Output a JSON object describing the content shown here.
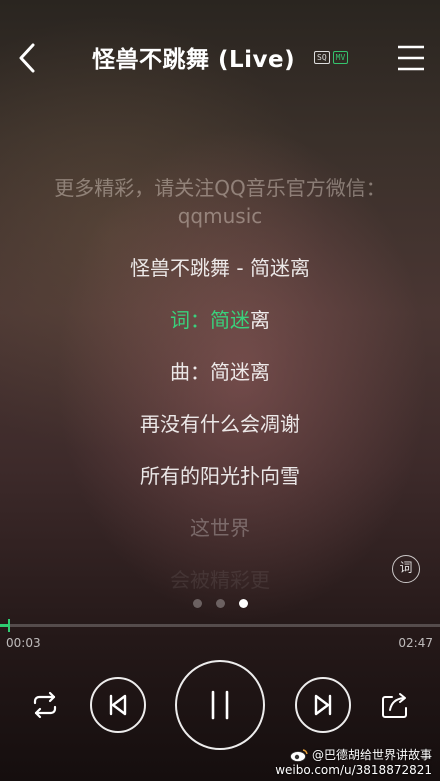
{
  "header": {
    "title": "怪兽不跳舞 (Live)",
    "badge_sq": "SQ",
    "badge_mv": "MV"
  },
  "lyrics": [
    "更多精彩，请关注QQ音乐官方微信：qqmusic",
    "怪兽不跳舞 - 简迷离",
    {
      "highlighted": "词：简迷",
      "rest": "离"
    },
    "曲：简迷离",
    "再没有什么会凋谢",
    "所有的阳光扑向雪",
    "这世界",
    "会被精彩更"
  ],
  "lyric_button": "词",
  "pager": {
    "pages": 3,
    "active_index": 2
  },
  "playback": {
    "current_time": "00:03",
    "total_time": "02:47",
    "progress_fraction": 0.02
  },
  "colors": {
    "accent": "#2ecc71"
  },
  "watermark": {
    "line1": "@巴德胡给世界讲故事",
    "line2": "weibo.com/u/3818872821"
  },
  "icons": {
    "back": "chevron-left-icon",
    "menu": "hamburger-menu-icon",
    "repeat": "repeat-icon",
    "prev": "skip-previous-icon",
    "pause": "pause-icon",
    "next": "skip-next-icon",
    "share": "share-icon",
    "weibo": "weibo-logo"
  }
}
